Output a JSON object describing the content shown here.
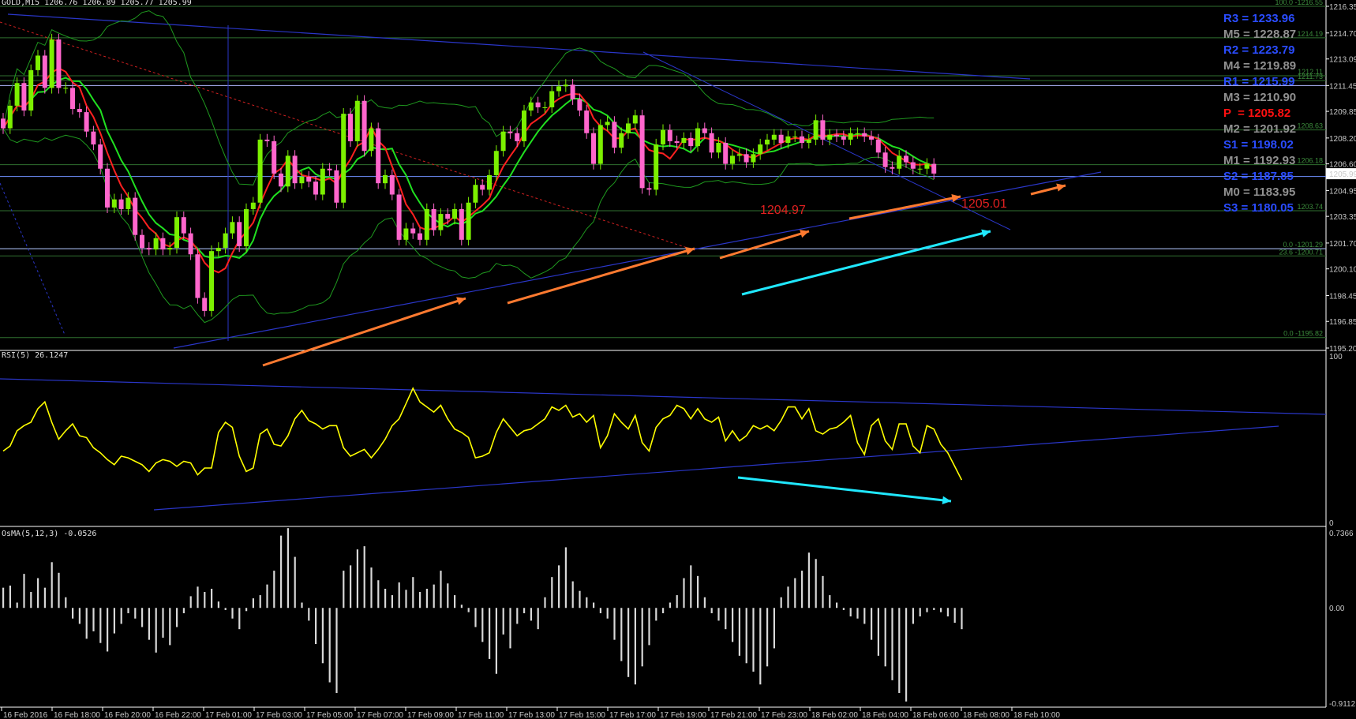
{
  "header": {
    "main": "GOLD,M15 1206.76 1206.89 1205.77 1205.99",
    "rsi": "RSI(5) 26.1247",
    "osma": "OsMA(5,12,3) -0.0526"
  },
  "current_price": "1205.99",
  "price_axis": [
    "1216.35",
    "1214.70",
    "1213.09",
    "1211.45",
    "1209.85",
    "1208.20",
    "1206.60",
    "1204.95",
    "1203.35",
    "1201.70",
    "1200.10",
    "1198.45",
    "1196.85",
    "1195.20"
  ],
  "rsi_axis": [
    "100",
    "0"
  ],
  "osma_axis": [
    "0.7366",
    "0.00",
    "-0.9112"
  ],
  "time_axis": [
    "16 Feb 2016",
    "16 Feb 18:00",
    "16 Feb 20:00",
    "16 Feb 22:00",
    "17 Feb 01:00",
    "17 Feb 03:00",
    "17 Feb 05:00",
    "17 Feb 07:00",
    "17 Feb 09:00",
    "17 Feb 11:00",
    "17 Feb 13:00",
    "17 Feb 15:00",
    "17 Feb 17:00",
    "17 Feb 19:00",
    "17 Feb 21:00",
    "17 Feb 23:00",
    "18 Feb 02:00",
    "18 Feb 04:00",
    "18 Feb 06:00",
    "18 Feb 08:00",
    "18 Feb 10:00"
  ],
  "pivots": [
    {
      "label": "R3 = 1233.96",
      "color": "#2a4cff"
    },
    {
      "label": "M5 = 1228.87",
      "color": "#909090"
    },
    {
      "label": "R2 = 1223.79",
      "color": "#2a4cff"
    },
    {
      "label": "M4 = 1219.89",
      "color": "#909090"
    },
    {
      "label": "R1 = 1215.99",
      "color": "#2a4cff"
    },
    {
      "label": "M3 = 1210.90",
      "color": "#909090"
    },
    {
      "label": "P  = 1205.82",
      "color": "#ff1010"
    },
    {
      "label": "M2 = 1201.92",
      "color": "#909090"
    },
    {
      "label": "S1 = 1198.02",
      "color": "#2a4cff"
    },
    {
      "label": "M1 = 1192.93",
      "color": "#909090"
    },
    {
      "label": "S2 = 1187.85",
      "color": "#2a4cff"
    },
    {
      "label": "M0 = 1183.95",
      "color": "#909090"
    },
    {
      "label": "S3 = 1180.05",
      "color": "#2a4cff"
    }
  ],
  "fib_labels": [
    {
      "label": "100.0 -1216.55",
      "price": 1216.35
    },
    {
      "label": "1214.19",
      "price": 1214.4
    },
    {
      "label": "1212.11",
      "price": 1212.05
    },
    {
      "label": "1211.73",
      "price": 1211.75
    },
    {
      "label": "1208.63",
      "price": 1208.7
    },
    {
      "label": "1206.18",
      "price": 1206.55
    },
    {
      "label": "1203.74",
      "price": 1203.7
    },
    {
      "label": "0.0 -1201.29",
      "price": 1201.35
    },
    {
      "label": "23.6 -1200.71",
      "price": 1200.9
    },
    {
      "label": "0.0 -1195.82",
      "price": 1195.85
    }
  ],
  "annotations": [
    {
      "text": "1204.97",
      "price": 1203.5,
      "time": "17 Feb 21:00"
    },
    {
      "text": "1205.01",
      "price": 1203.9,
      "time": "18 Feb 08:00"
    }
  ],
  "colors": {
    "up": "#7cf000",
    "down": "#ff66cc",
    "ma_fast": "#ff2020",
    "ma_slow": "#20e020",
    "bands": "#1f9a1f",
    "trend": "#2a36c8",
    "arrow_orange": "#ff7a30",
    "arrow_cyan": "#20e8ff",
    "rsi": "#ffff00",
    "osma": "#d8d8d8"
  },
  "chart_data": {
    "type": "candlestick",
    "symbol": "GOLD",
    "timeframe": "M15",
    "ylim": [
      1195.2,
      1216.35
    ],
    "close": [
      1208.8,
      1210.2,
      1211.6,
      1209.9,
      1212.4,
      1213.3,
      1211.3,
      1214.3,
      1211.3,
      1211.3,
      1210.0,
      1209.8,
      1208.6,
      1207.8,
      1206.3,
      1203.9,
      1204.4,
      1203.8,
      1204.5,
      1202.2,
      1201.4,
      1201.3,
      1202.0,
      1201.3,
      1201.4,
      1203.3,
      1202.3,
      1201.0,
      1198.3,
      1197.5,
      1201.2,
      1201.4,
      1202.3,
      1203.0,
      1201.5,
      1203.8,
      1204.2,
      1208.1,
      1208.0,
      1206.0,
      1205.2,
      1207.1,
      1205.4,
      1205.8,
      1205.5,
      1204.7,
      1206.3,
      1206.2,
      1204.2,
      1209.7,
      1208.0,
      1210.5,
      1207.4,
      1208.8,
      1205.4,
      1205.9,
      1204.7,
      1201.9,
      1202.6,
      1202.3,
      1201.9,
      1203.8,
      1202.5,
      1203.5,
      1203.2,
      1203.8,
      1201.9,
      1204.2,
      1205.3,
      1205.0,
      1205.9,
      1207.4,
      1208.6,
      1208.5,
      1208.0,
      1209.9,
      1210.4,
      1210.1,
      1210.1,
      1211.1,
      1211.4,
      1211.5,
      1210.6,
      1209.9,
      1208.5,
      1206.6,
      1209.0,
      1209.2,
      1207.6,
      1208.5,
      1209.1,
      1209.6,
      1205.1,
      1205.0,
      1207.8,
      1208.7,
      1208.0,
      1207.9,
      1208.2,
      1207.7,
      1208.8,
      1208.5,
      1207.3,
      1207.9,
      1206.6,
      1207.1,
      1207.2,
      1206.7,
      1207.2,
      1207.8,
      1208.1,
      1208.4,
      1207.9,
      1208.3,
      1208.3,
      1207.9,
      1208.1,
      1209.3,
      1208.1,
      1208.4,
      1208.3,
      1208.1,
      1208.5,
      1208.5,
      1208.3,
      1208.1,
      1207.3,
      1206.4,
      1206.3,
      1207.1,
      1206.7,
      1206.3,
      1206.3,
      1206.6,
      1206.0
    ],
    "rsi": {
      "range": [
        0,
        100
      ],
      "values": [
        43,
        46,
        55,
        58,
        60,
        68,
        72,
        60,
        50,
        55,
        59,
        52,
        51,
        45,
        42,
        38,
        35,
        40,
        39,
        37,
        35,
        31,
        36,
        38,
        37,
        34,
        37,
        36,
        29,
        33,
        33,
        54,
        60,
        57,
        40,
        31,
        33,
        53,
        56,
        47,
        46,
        52,
        62,
        67,
        61,
        59,
        56,
        58,
        58,
        45,
        40,
        42,
        44,
        39,
        44,
        50,
        58,
        62,
        71,
        80,
        72,
        69,
        66,
        70,
        62,
        56,
        54,
        51,
        39,
        40,
        42,
        54,
        62,
        57,
        52,
        55,
        56,
        59,
        62,
        69,
        67,
        70,
        63,
        65,
        60,
        64,
        45,
        52,
        65,
        60,
        56,
        64,
        48,
        43,
        57,
        62,
        64,
        70,
        68,
        62,
        68,
        62,
        60,
        63,
        49,
        55,
        49,
        52,
        58,
        56,
        58,
        55,
        61,
        69,
        69,
        62,
        68,
        55,
        53,
        56,
        57,
        60,
        64,
        48,
        41,
        58,
        62,
        49,
        44,
        59,
        59,
        46,
        42,
        58,
        56,
        47,
        42,
        34,
        26
      ]
    },
    "osma": {
      "range": [
        -0.9112,
        0.7366
      ],
      "values": [
        0.19,
        0.21,
        0.05,
        0.32,
        0.15,
        0.28,
        0.19,
        0.43,
        0.33,
        0.1,
        -0.1,
        -0.15,
        -0.29,
        -0.22,
        -0.33,
        -0.41,
        -0.24,
        -0.15,
        -0.05,
        -0.1,
        -0.18,
        -0.3,
        -0.42,
        -0.28,
        -0.35,
        -0.18,
        -0.05,
        0.11,
        0.2,
        0.15,
        0.18,
        0.06,
        -0.02,
        -0.1,
        -0.2,
        -0.03,
        0.09,
        0.12,
        0.22,
        0.35,
        0.68,
        0.75,
        0.48,
        0.05,
        -0.12,
        -0.34,
        -0.52,
        -0.7,
        -0.8,
        0.35,
        0.4,
        0.55,
        0.58,
        0.38,
        0.26,
        0.18,
        0.12,
        0.24,
        0.17,
        0.29,
        0.15,
        0.18,
        0.22,
        0.35,
        0.23,
        0.12,
        0.03,
        -0.04,
        -0.18,
        -0.32,
        -0.48,
        -0.62,
        -0.25,
        -0.38,
        -0.15,
        -0.05,
        -0.12,
        -0.2,
        0.1,
        0.29,
        0.4,
        0.57,
        0.25,
        0.16,
        0.1,
        0.05,
        -0.05,
        -0.1,
        -0.3,
        -0.5,
        -0.65,
        -0.72,
        -0.55,
        -0.35,
        -0.12,
        -0.05,
        0.05,
        0.12,
        0.28,
        0.4,
        0.3,
        0.1,
        -0.05,
        -0.12,
        -0.2,
        -0.32,
        -0.45,
        -0.52,
        -0.6,
        -0.72,
        -0.55,
        -0.38,
        0.1,
        0.2,
        0.28,
        0.35,
        0.52,
        0.46,
        0.3,
        0.12,
        0.05,
        -0.02,
        -0.08,
        -0.1,
        -0.15,
        -0.3,
        -0.45,
        -0.55,
        -0.68,
        -0.8,
        -0.88,
        -0.15,
        -0.08,
        -0.04,
        -0.02,
        -0.04,
        -0.08,
        -0.14,
        -0.2
      ]
    }
  }
}
